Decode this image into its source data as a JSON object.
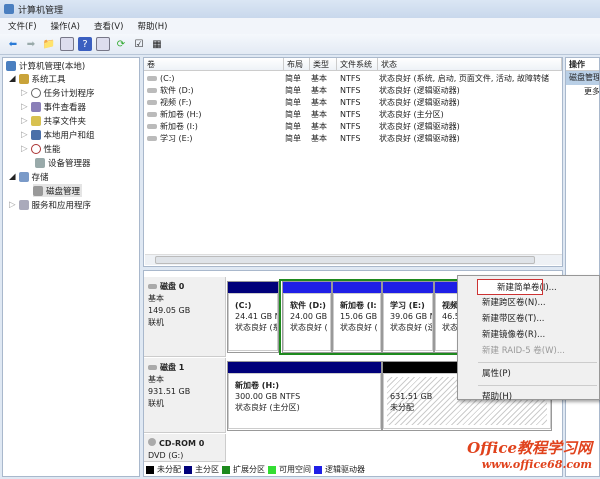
{
  "window": {
    "title": "计算机管理"
  },
  "menu": [
    "文件(F)",
    "操作(A)",
    "查看(V)",
    "帮助(H)"
  ],
  "tree": [
    {
      "label": "计算机管理(本地)",
      "level": 0
    },
    {
      "label": "系统工具",
      "level": 1
    },
    {
      "label": "任务计划程序",
      "level": 2
    },
    {
      "label": "事件查看器",
      "level": 2
    },
    {
      "label": "共享文件夹",
      "level": 2
    },
    {
      "label": "本地用户和组",
      "level": 2
    },
    {
      "label": "性能",
      "level": 2
    },
    {
      "label": "设备管理器",
      "level": 2
    },
    {
      "label": "存储",
      "level": 1
    },
    {
      "label": "磁盘管理",
      "level": 2
    },
    {
      "label": "服务和应用程序",
      "level": 1
    }
  ],
  "volumes": {
    "headers": [
      "卷",
      "布局",
      "类型",
      "文件系统",
      "状态"
    ],
    "rows": [
      [
        "(C:)",
        "简单",
        "基本",
        "NTFS",
        "状态良好 (系统, 启动, 页面文件, 活动, 故障转储"
      ],
      [
        "软件 (D:)",
        "简单",
        "基本",
        "NTFS",
        "状态良好 (逻辑驱动器)"
      ],
      [
        "视频 (F:)",
        "简单",
        "基本",
        "NTFS",
        "状态良好 (逻辑驱动器)"
      ],
      [
        "新加卷 (H:)",
        "简单",
        "基本",
        "NTFS",
        "状态良好 (主分区)"
      ],
      [
        "新加卷 (I:)",
        "简单",
        "基本",
        "NTFS",
        "状态良好 (逻辑驱动器)"
      ],
      [
        "学习 (E:)",
        "简单",
        "基本",
        "NTFS",
        "状态良好 (逻辑驱动器)"
      ]
    ]
  },
  "disks": [
    {
      "name": "磁盘 0",
      "type": "基本",
      "size": "149.05 GB",
      "status": "联机",
      "parts": [
        {
          "name": "(C:)",
          "size": "24.41 GB N",
          "state": "状态良好 (系"
        },
        {
          "name": "软件  (D:)",
          "size": "24.00 GB",
          "state": "状态良好 ("
        },
        {
          "name": "新加卷  (I:",
          "size": "15.06 GB",
          "state": "状态良好 ("
        },
        {
          "name": "学习  (E:)",
          "size": "39.06 GB N",
          "state": "状态良好 (逻"
        },
        {
          "name": "视频",
          "size": "46.5",
          "state": "状态"
        }
      ]
    },
    {
      "name": "磁盘 1",
      "type": "基本",
      "size": "931.51 GB",
      "status": "联机",
      "parts": [
        {
          "name": "新加卷  (H:)",
          "size": "300.00 GB NTFS",
          "state": "状态良好 (主分区)"
        },
        {
          "name": "",
          "size": "631.51 GB",
          "state": "未分配"
        }
      ]
    },
    {
      "name": "CD-ROM 0",
      "type": "DVD (G:)"
    }
  ],
  "legend": [
    {
      "label": "未分配",
      "color": "#000000"
    },
    {
      "label": "主分区",
      "color": "#00007a"
    },
    {
      "label": "扩展分区",
      "color": "#1e8a1e"
    },
    {
      "label": "可用空间",
      "color": "#33dd33"
    },
    {
      "label": "逻辑驱动器",
      "color": "#1f1fe6"
    }
  ],
  "actions": {
    "title": "操作",
    "selected": "磁盘管理",
    "more": "更多操作"
  },
  "context_menu": [
    "新建简单卷(I)...",
    "新建跨区卷(N)...",
    "新建带区卷(T)...",
    "新建镜像卷(R)...",
    "新建 RAID-5 卷(W)...",
    "属性(P)",
    "帮助(H)"
  ],
  "watermark": {
    "line1": "Office教程学习网",
    "line2": "www.office68.com"
  }
}
